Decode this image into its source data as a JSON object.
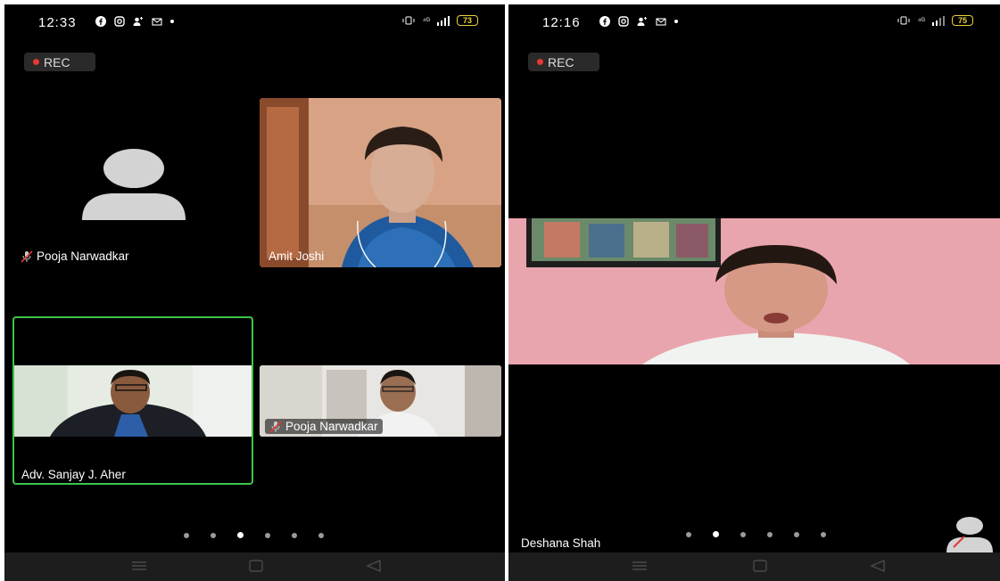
{
  "left": {
    "status": {
      "time": "12:33",
      "network": "⁴ᴳ",
      "battery": "73"
    },
    "rec_label": "REC",
    "tiles": {
      "avatar_name": "Pooja Narwadkar",
      "amit_name": "Amit Joshi",
      "sanjay_name": "Adv. Sanjay J. Aher",
      "pooja_video_name": "Pooja Narwadkar"
    },
    "page_dots": {
      "count": 6,
      "active_index": 2
    }
  },
  "right": {
    "status": {
      "time": "12:16",
      "network": "⁴ᴳ",
      "battery": "75"
    },
    "rec_label": "REC",
    "speaker_name": "Deshana Shah",
    "page_dots": {
      "count": 6,
      "active_index": 1
    }
  },
  "colors": {
    "active_speaker_border": "#3fc44a",
    "rec_dot": "#e53935",
    "battery": "#e9d23a"
  }
}
